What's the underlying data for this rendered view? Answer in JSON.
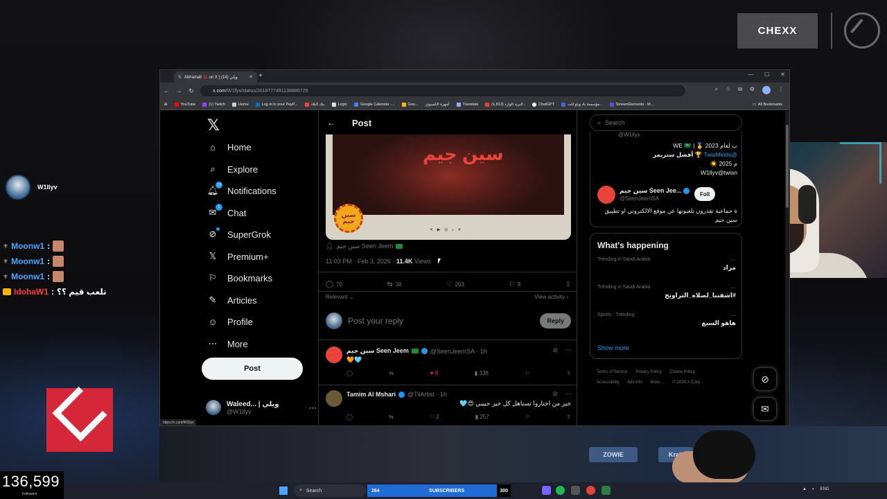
{
  "overlay": {
    "sponsor_logo": "CHEXX",
    "chat_user": "W1llyv",
    "chat_lines": [
      {
        "name": "Moonw1",
        "msg": ""
      },
      {
        "name": "Moonw1",
        "msg": ""
      },
      {
        "name": "Moonw1",
        "msg": ""
      },
      {
        "name": "IdohaW1",
        "msg": "نلعب قيم ؟؟"
      }
    ],
    "followers_count": "136,599",
    "followers_label": "Followers"
  },
  "taskbar": {
    "search": "Search",
    "subs_left": "264",
    "subs_label": "SUBSCRIBERS",
    "subs_right": "300",
    "lang": "ENG"
  },
  "browser": {
    "tab_title": "Abhamall 🐞 on X | ويلي (14)",
    "url_host": "x.com",
    "url_path": "/W1llyv/status/2018777481138880729",
    "bookmarks": [
      "YouTube",
      "(1) Twitch",
      "Home",
      "Log in to your PayP...",
      "بنك البلاد",
      "Login",
      "Google Calendar -...",
      "Goo...",
      "أجهزة الكمبيوتر",
      "Translate",
      "(1,813) البريد الوارد -",
      "ChatGPT",
      "مؤسسة باد وباو للت...",
      "StreamElements - M..."
    ],
    "bookmarks_all": "All Bookmarks",
    "status_url": "https://x.com/W1llyv"
  },
  "sidebar": {
    "items": [
      {
        "label": "Home",
        "icon": "home-icon",
        "glyph": "⌂"
      },
      {
        "label": "Explore",
        "icon": "search-icon",
        "glyph": "⌕"
      },
      {
        "label": "Notifications",
        "icon": "bell-icon",
        "glyph": "🔔︎",
        "badge": "13"
      },
      {
        "label": "Chat",
        "icon": "chat-icon",
        "glyph": "✉",
        "badge": "1"
      },
      {
        "label": "SuperGrok",
        "icon": "grok-icon",
        "glyph": "⊘",
        "dot": true
      },
      {
        "label": "Premium+",
        "icon": "x-premium-icon",
        "glyph": "𝕏"
      },
      {
        "label": "Bookmarks",
        "icon": "bookmark-icon",
        "glyph": "⚐"
      },
      {
        "label": "Articles",
        "icon": "articles-icon",
        "glyph": "✎"
      },
      {
        "label": "Profile",
        "icon": "profile-icon",
        "glyph": "☺"
      },
      {
        "label": "More",
        "icon": "more-icon",
        "glyph": "⋯"
      }
    ],
    "post_button": "Post",
    "account_name": "Waleed... | ويلي",
    "account_handle": "@W1llyv"
  },
  "post": {
    "header_title": "Post",
    "media_title": "سين جيم",
    "media_badge": "سين جيم",
    "tagged": "سين جيم Seen Jeem",
    "time": "11:03 PM · Feb 3, 2026 · ",
    "views_count": "11.4K",
    "views_label": " Views",
    "replies": "70",
    "reposts": "38",
    "likes": "203",
    "bookmarks": "8",
    "relevant": "Relevant",
    "view_activity": "View activity",
    "reply_placeholder": "Post your reply",
    "reply_button": "Reply"
  },
  "comments": [
    {
      "name": "سين جيم Seen Jeem",
      "handle": "@SeenJeemSA · 1h",
      "text": "🧡🩵",
      "rtl": false,
      "replies": "",
      "reposts": "",
      "likes": "8",
      "views": "338",
      "avatar_color": "#e8443a",
      "liked": true
    },
    {
      "name": "Tamim Al Mshari",
      "handle": "@TiiArtist · 1h",
      "text": "خير من اختاروا تستاهل كل خير حبيبي 😍🩵",
      "rtl": true,
      "replies": "",
      "reposts": "",
      "likes": "2",
      "views": "257",
      "avatar_color": "#6a5a3a",
      "liked": false
    }
  ],
  "rightcol": {
    "search_placeholder": "Search",
    "card_handle1": "@W1llyv",
    "card_bio1_a": "ب لعام 2023 🏅 | WE 🇸🇦",
    "card_bio1_b": "@TwisMinds",
    "card_bio1_c": "🏆 أفضل ستريمر",
    "card_bio1_d": "م 2025 ☀️",
    "card_bio1_e": "W1llyv@twisn",
    "card_name2": "سين جيم Seen Jee...",
    "card_handle2": "@SeenJeemSA",
    "card_follow": "Foll",
    "card_bio2": "ة جماعية تقدرون تلعبونها عن موقع الالكتروني او تطبيق سين جيم",
    "trends_title": "What's happening",
    "trends": [
      {
        "ctx": "Trending in Saudi Arabia",
        "name": "مراد"
      },
      {
        "ctx": "Trending in Saudi Arabia",
        "name": "#اشفتنا_لصلاه_التراويح"
      },
      {
        "ctx": "Sports · Trending",
        "name": "هاهو السبع"
      }
    ],
    "show_more": "Show more",
    "footer": [
      "Terms of Service",
      "Privacy Policy",
      "Cookie Policy",
      "Accessibility",
      "Ads info",
      "More ...",
      "© 2026 X Corp."
    ]
  }
}
